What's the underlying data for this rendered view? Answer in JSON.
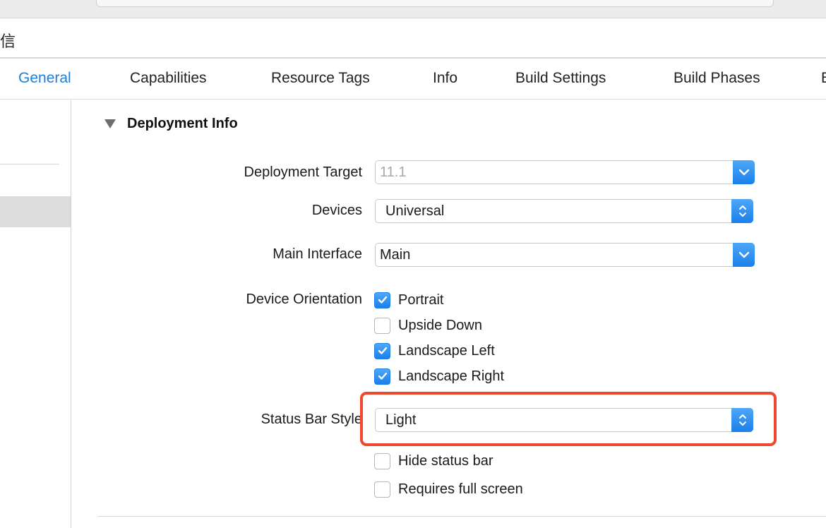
{
  "window": {
    "title": "信"
  },
  "tabs": [
    {
      "label": "General",
      "active": true
    },
    {
      "label": "Capabilities"
    },
    {
      "label": "Resource Tags"
    },
    {
      "label": "Info"
    },
    {
      "label": "Build Settings"
    },
    {
      "label": "Build Phases"
    },
    {
      "label": "B"
    }
  ],
  "deployment": {
    "section_title": "Deployment Info",
    "deployment_target": {
      "label": "Deployment Target",
      "value": "11.1"
    },
    "devices": {
      "label": "Devices",
      "value": "Universal"
    },
    "main_interface": {
      "label": "Main Interface",
      "value": "Main"
    },
    "orientation": {
      "label": "Device Orientation",
      "options": [
        {
          "label": "Portrait",
          "checked": true
        },
        {
          "label": "Upside Down",
          "checked": false
        },
        {
          "label": "Landscape Left",
          "checked": true
        },
        {
          "label": "Landscape Right",
          "checked": true
        }
      ]
    },
    "status_bar": {
      "label": "Status Bar Style",
      "value": "Light",
      "hide": {
        "label": "Hide status bar",
        "checked": false
      },
      "full_screen": {
        "label": "Requires full screen",
        "checked": false
      }
    }
  },
  "colors": {
    "accent": "#1f7ed6",
    "highlight": "#f0472f"
  }
}
